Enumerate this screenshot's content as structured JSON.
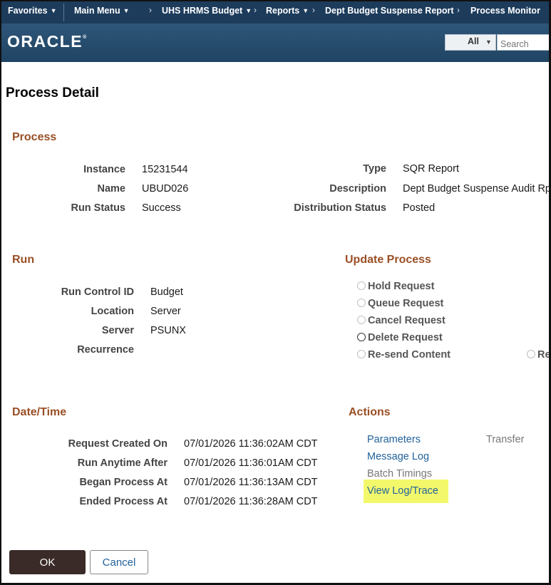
{
  "nav": {
    "favorites": "Favorites",
    "main_menu": "Main Menu",
    "breadcrumbs": [
      "UHS HRMS Budget",
      "Reports",
      "Dept Budget Suspense Report",
      "Process Monitor"
    ]
  },
  "banner": {
    "logo": "ORACLE",
    "logo_mark": "®",
    "search_scope": "All",
    "search_placeholder": "Search"
  },
  "page": {
    "title": "Process Detail"
  },
  "process": {
    "heading": "Process",
    "instance_label": "Instance",
    "instance": "15231544",
    "name_label": "Name",
    "name": "UBUD026",
    "run_status_label": "Run Status",
    "run_status": "Success",
    "type_label": "Type",
    "type": "SQR Report",
    "description_label": "Description",
    "description": "Dept Budget Suspense Audit Rpt",
    "distribution_status_label": "Distribution Status",
    "distribution_status": "Posted"
  },
  "run": {
    "heading": "Run",
    "run_control_id_label": "Run Control ID",
    "run_control_id": "Budget",
    "location_label": "Location",
    "location": "Server",
    "server_label": "Server",
    "server": "PSUNX",
    "recurrence_label": "Recurrence",
    "recurrence": ""
  },
  "update_process": {
    "heading": "Update Process",
    "options": [
      "Hold Request",
      "Queue Request",
      "Cancel Request",
      "Delete Request",
      "Re-send Content",
      "Re"
    ]
  },
  "datetime": {
    "heading": "Date/Time",
    "request_created_label": "Request Created On",
    "request_created": "07/01/2026 11:36:02AM CDT",
    "run_anytime_label": "Run Anytime After",
    "run_anytime": "07/01/2026 11:36:01AM CDT",
    "began_label": "Began Process At",
    "began": "07/01/2026 11:36:13AM CDT",
    "ended_label": "Ended Process At",
    "ended": "07/01/2026 11:36:28AM CDT"
  },
  "actions": {
    "heading": "Actions",
    "parameters": "Parameters",
    "transfer": "Transfer",
    "message_log": "Message Log",
    "batch_timings": "Batch Timings",
    "view_log_trace": "View Log/Trace",
    "highlight_color": "#f3f86b"
  },
  "buttons": {
    "ok": "OK",
    "cancel": "Cancel"
  }
}
